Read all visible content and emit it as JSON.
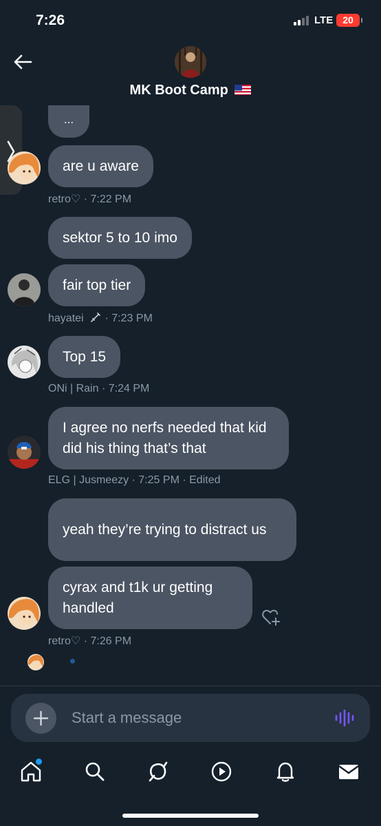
{
  "status_bar": {
    "time": "7:26",
    "network": "LTE",
    "battery": "20"
  },
  "header": {
    "title": "MK Boot Camp",
    "flag_icon": "us-flag-icon"
  },
  "messages": [
    {
      "text": "...",
      "sender": "retro"
    },
    {
      "text": "are u aware",
      "sender": "retro"
    },
    {
      "text": "sektor 5 to 10 imo",
      "sender": "hayatei"
    },
    {
      "text": "fair top tier",
      "sender": "hayatei"
    },
    {
      "text": "Top 15",
      "sender": "ONi | Rain"
    },
    {
      "text": "I agree no nerfs needed that kid did his thing that’s that",
      "sender": "ELG | Jusmeezy"
    },
    {
      "text": "yeah they’re trying to distract us",
      "sender": "retro"
    },
    {
      "text": "cyrax and t1k ur getting handled",
      "sender": "retro"
    }
  ],
  "meta": [
    {
      "name": "retro♡",
      "time": "7:22 PM",
      "edited": ""
    },
    {
      "name": "hayatei",
      "time": "7:23 PM",
      "edited": ""
    },
    {
      "name": "ONi | Rain",
      "time": "7:24 PM",
      "edited": ""
    },
    {
      "name": "ELG | Jusmeezy",
      "time": "7:25 PM",
      "edited": "Edited"
    },
    {
      "name": "retro♡",
      "time": "7:26 PM",
      "edited": ""
    }
  ],
  "separator": " · ",
  "composer": {
    "placeholder": "Start a message"
  },
  "tabbar": [
    "home-icon",
    "search-icon",
    "grok-icon",
    "play-icon",
    "bell-icon",
    "mail-icon"
  ],
  "colors": {
    "background": "#15202b",
    "bubble": "#4b5563",
    "accent": "#1d9bf0",
    "voice": "#7856ff"
  }
}
